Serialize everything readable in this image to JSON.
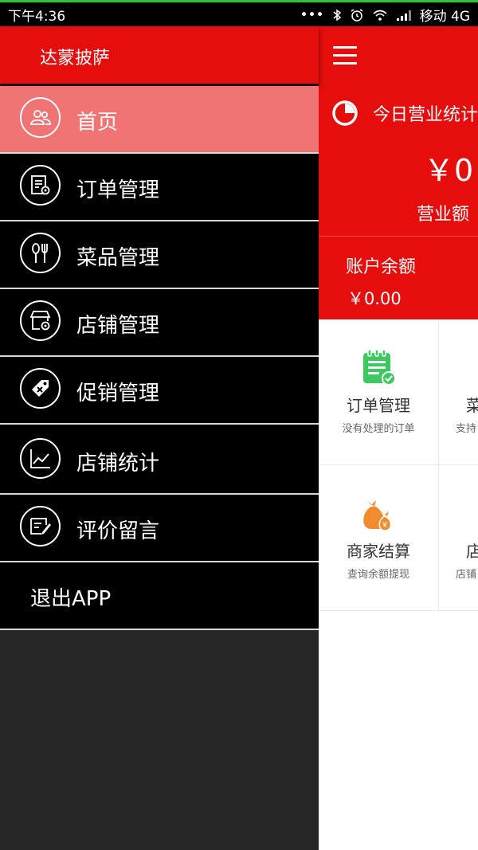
{
  "status_bar": {
    "time": "下午4:36",
    "carrier": "移动 4G",
    "icons": [
      "more-dots-icon",
      "bluetooth-icon",
      "alarm-icon",
      "wifi-icon",
      "signal-icon"
    ]
  },
  "drawer": {
    "title": "达蒙披萨",
    "items": [
      {
        "label": "首页",
        "icon": "people-icon",
        "active": true
      },
      {
        "label": "订单管理",
        "icon": "order-document-icon"
      },
      {
        "label": "菜品管理",
        "icon": "cutlery-icon"
      },
      {
        "label": "店铺管理",
        "icon": "shop-settings-icon"
      },
      {
        "label": "促销管理",
        "icon": "promotion-tag-icon"
      },
      {
        "label": "店铺统计",
        "icon": "line-chart-icon"
      },
      {
        "label": "评价留言",
        "icon": "comment-edit-icon"
      },
      {
        "label": "退出APP"
      }
    ]
  },
  "main": {
    "stats_title": "今日营业统计",
    "revenue_value": "￥0",
    "revenue_label": "营业额",
    "balance_title": "账户余额",
    "balance_value": "￥0.00",
    "grid": [
      {
        "title": "订单管理",
        "sub": "没有处理的订单",
        "icon": "order-list-icon"
      },
      {
        "title": "菜",
        "sub": "支持",
        "icon": "dish-icon"
      },
      {
        "title": "商家结算",
        "sub": "查询余额提现",
        "icon": "money-bag-icon"
      },
      {
        "title": "店",
        "sub": "店铺",
        "icon": "shop-icon"
      }
    ]
  },
  "colors": {
    "brand_red": "#e60d0d",
    "active_item": "#f07474",
    "drawer_bg": "#000000",
    "green_icon": "#3cc95f",
    "orange_icon": "#f08b2f"
  }
}
